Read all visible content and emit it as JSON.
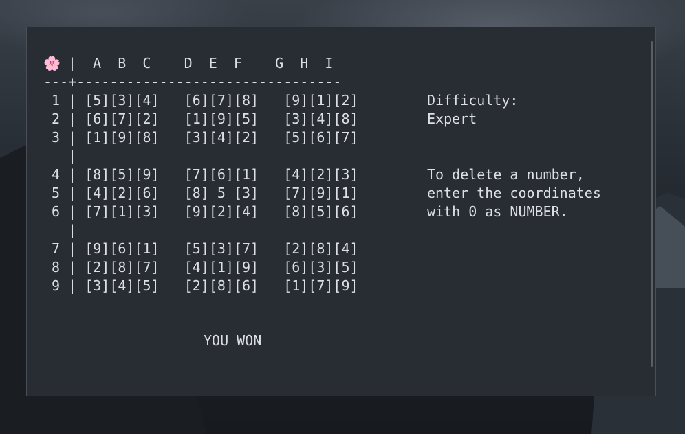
{
  "header": {
    "icon": "cherry-blossom-icon",
    "icon_glyph": "🌸",
    "columns_text": " |  A  B  C    D  E  F    G  H  I"
  },
  "separator": "---+--------------------------------",
  "rows": [
    " 1 | [5][3][4]   [6][7][8]   [9][1][2]",
    " 2 | [6][7][2]   [1][9][5]   [3][4][8]",
    " 3 | [1][9][8]   [3][4][2]   [5][6][7]",
    "   |",
    " 4 | [8][5][9]   [7][6][1]   [4][2][3]",
    " 5 | [4][2][6]   [8] 5 [3]   [7][9][1]",
    " 6 | [7][1][3]   [9][2][4]   [8][5][6]",
    "   |",
    " 7 | [9][6][1]   [5][3][7]   [2][8][4]",
    " 8 | [2][8][7]   [4][1][9]   [6][3][5]",
    " 9 | [3][4][5]   [2][8][6]   [1][7][9]"
  ],
  "info": {
    "difficulty_label": "Difficulty:",
    "difficulty_value": "Expert",
    "help_1": "To delete a number,",
    "help_2": "enter the coordinates",
    "help_3": "with 0 as NUMBER."
  },
  "status": "YOU WON",
  "colors": {
    "terminal_bg": "#282c33",
    "text": "#dcdfe4"
  }
}
